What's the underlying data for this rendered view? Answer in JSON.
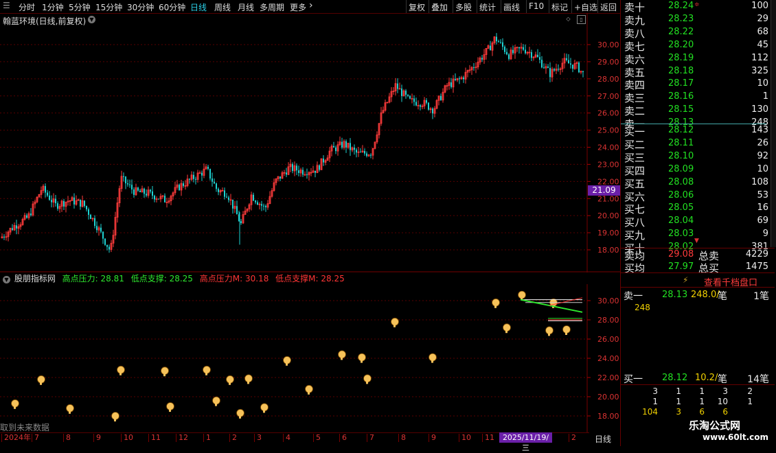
{
  "toolbar": {
    "periods": [
      "分时",
      "1分钟",
      "5分钟",
      "15分钟",
      "30分钟",
      "60分钟",
      "日线",
      "周线",
      "月线",
      "多周期",
      "更多"
    ],
    "active_period": "日线",
    "actions": [
      "复权",
      "叠加",
      "多股",
      "统计",
      "画线",
      "F10",
      "标记",
      "+自选",
      "返回"
    ]
  },
  "chart": {
    "title": "翰蓝环境(日线,前复权)",
    "price_tag": "21.09",
    "y_ticks": [
      "30.00",
      "29.00",
      "28.00",
      "27.00",
      "26.00",
      "25.00",
      "24.00",
      "23.00",
      "22.00",
      "21.00",
      "20.00",
      "19.00",
      "18.00"
    ],
    "x_ticks": [
      "2024年",
      "7",
      "8",
      "9",
      "10",
      "11",
      "12",
      "1",
      "2",
      "3",
      "4",
      "5",
      "6",
      "7",
      "8",
      "9",
      "10",
      "11",
      "2"
    ],
    "date_box": "2025/11/19/三",
    "period_label": "日线",
    "colors": {
      "up": "#ff3b3b",
      "down": "#1ed2d2",
      "grid": "#4a0000"
    }
  },
  "chart_data": {
    "type": "candlestick",
    "title": "翰蓝环境(日线,前复权)",
    "ylim": [
      17.5,
      31.0
    ],
    "x_labels": [
      "2024年",
      "7",
      "8",
      "9",
      "10",
      "11",
      "12",
      "1",
      "2",
      "3",
      "4",
      "5",
      "6",
      "7",
      "8",
      "9",
      "10",
      "11",
      "2"
    ],
    "anchors_close": [
      [
        0,
        18.7
      ],
      [
        20,
        19.4
      ],
      [
        40,
        19.9
      ],
      [
        60,
        21.6
      ],
      [
        80,
        20.6
      ],
      [
        100,
        20.9
      ],
      [
        120,
        20.7
      ],
      [
        140,
        19.4
      ],
      [
        160,
        17.9
      ],
      [
        175,
        22.2
      ],
      [
        195,
        21.4
      ],
      [
        215,
        21.3
      ],
      [
        240,
        20.9
      ],
      [
        260,
        21.7
      ],
      [
        280,
        22.2
      ],
      [
        300,
        22.7
      ],
      [
        315,
        21.5
      ],
      [
        330,
        21.3
      ],
      [
        350,
        19.5
      ],
      [
        365,
        21.2
      ],
      [
        385,
        20.4
      ],
      [
        400,
        22.0
      ],
      [
        420,
        22.8
      ],
      [
        440,
        22.6
      ],
      [
        460,
        22.7
      ],
      [
        480,
        23.8
      ],
      [
        500,
        24.2
      ],
      [
        520,
        23.6
      ],
      [
        540,
        23.7
      ],
      [
        555,
        26.0
      ],
      [
        575,
        27.6
      ],
      [
        595,
        26.7
      ],
      [
        615,
        26.6
      ],
      [
        630,
        26.2
      ],
      [
        650,
        27.6
      ],
      [
        670,
        28.0
      ],
      [
        690,
        28.8
      ],
      [
        710,
        29.7
      ],
      [
        720,
        30.4
      ],
      [
        740,
        29.4
      ],
      [
        760,
        29.8
      ],
      [
        780,
        29.3
      ],
      [
        800,
        28.3
      ],
      [
        820,
        29.0
      ],
      [
        840,
        28.7
      ],
      [
        850,
        28.2
      ]
    ],
    "indicator": {
      "name": "股朋指标网",
      "labels": [
        {
          "text": "高点压力: 28.81",
          "color": "#2ee82e"
        },
        {
          "text": "低点支撑: 28.25",
          "color": "#2ee82e"
        },
        {
          "text": "高点压力M: 30.18",
          "color": "#ff3535"
        },
        {
          "text": "低点支撑M: 28.25",
          "color": "#ff3535"
        }
      ],
      "y_ticks": [
        "30.00",
        "28.00",
        "26.00",
        "24.00",
        "22.00",
        "20.00",
        "18.00"
      ],
      "future_label": "取到未来数据"
    }
  },
  "orderbook": {
    "asks": [
      {
        "label": "卖十",
        "price": "28.24",
        "vol": "100"
      },
      {
        "label": "卖九",
        "price": "28.23",
        "vol": "29"
      },
      {
        "label": "卖八",
        "price": "28.22",
        "vol": "68"
      },
      {
        "label": "卖七",
        "price": "28.20",
        "vol": "45"
      },
      {
        "label": "卖六",
        "price": "28.19",
        "vol": "112"
      },
      {
        "label": "卖五",
        "price": "28.18",
        "vol": "325"
      },
      {
        "label": "卖四",
        "price": "28.17",
        "vol": "10"
      },
      {
        "label": "卖三",
        "price": "28.16",
        "vol": "1"
      },
      {
        "label": "卖二",
        "price": "28.15",
        "vol": "130"
      },
      {
        "label": "卖一",
        "price": "28.13",
        "vol": "248"
      }
    ],
    "bids": [
      {
        "label": "买一",
        "price": "28.12",
        "vol": "143"
      },
      {
        "label": "买二",
        "price": "28.11",
        "vol": "26"
      },
      {
        "label": "买三",
        "price": "28.10",
        "vol": "92"
      },
      {
        "label": "买四",
        "price": "28.09",
        "vol": "10"
      },
      {
        "label": "买五",
        "price": "28.08",
        "vol": "108"
      },
      {
        "label": "买六",
        "price": "28.06",
        "vol": "53"
      },
      {
        "label": "买七",
        "price": "28.05",
        "vol": "16"
      },
      {
        "label": "买八",
        "price": "28.04",
        "vol": "69"
      },
      {
        "label": "买九",
        "price": "28.03",
        "vol": "9"
      },
      {
        "label": "买十",
        "price": "28.02",
        "vol": "381"
      }
    ],
    "avg_sell": {
      "label": "卖均",
      "price": "29.08",
      "total_label": "总卖",
      "total": "4229"
    },
    "avg_buy": {
      "label": "买均",
      "price": "27.97",
      "total_label": "总买",
      "total": "1475"
    },
    "queue_link": "查看千档盘口",
    "ask1_detail": {
      "label": "卖一",
      "price": "28.13",
      "amount": "248.0/",
      "unit": "笔",
      "count": "1笔",
      "queue": "248"
    },
    "bid1_detail": {
      "label": "买一",
      "price": "28.12",
      "amount": "10.2/",
      "unit": "笔",
      "count": "14笔"
    },
    "bid_queue": [
      [
        "3",
        "1",
        "1",
        "3",
        "2"
      ],
      [
        "1",
        "1",
        "1",
        "10",
        "1"
      ],
      [
        "104",
        "3",
        "6",
        "6",
        ""
      ]
    ]
  },
  "logo": {
    "line1": "乐淘公式网",
    "line2": "www.60lt.com"
  }
}
